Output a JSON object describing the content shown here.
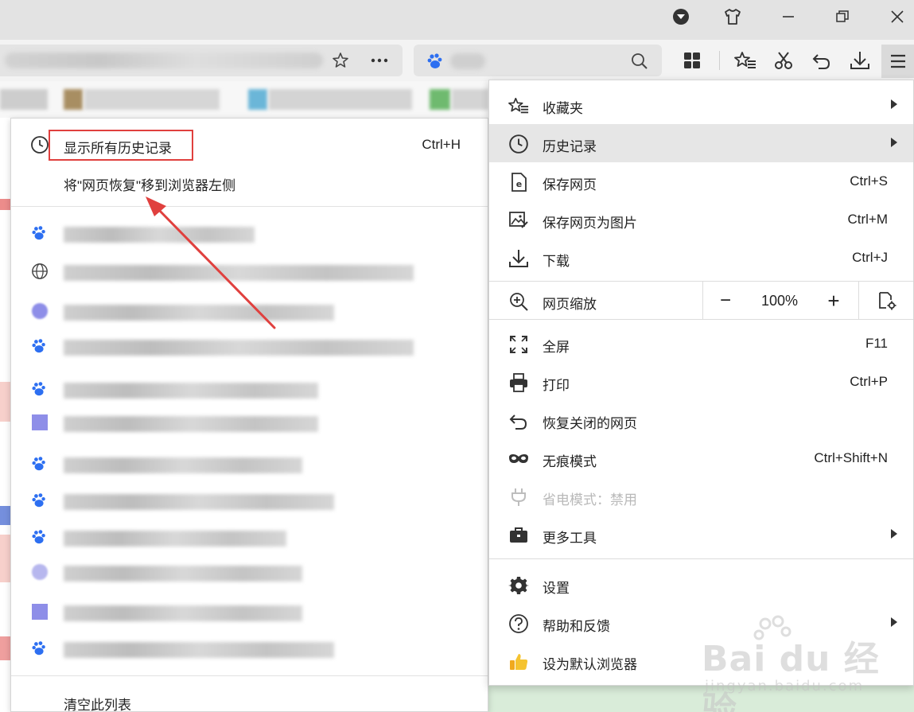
{
  "history_menu": {
    "show_all": {
      "label": "显示所有历史记录",
      "shortcut": "Ctrl+H"
    },
    "move_restore": {
      "label": "将\"网页恢复\"移到浏览器左侧"
    },
    "clear_list": {
      "label": "清空此列表"
    }
  },
  "main_menu": {
    "favorites": {
      "label": "收藏夹"
    },
    "history": {
      "label": "历史记录"
    },
    "save_page": {
      "label": "保存网页",
      "shortcut": "Ctrl+S"
    },
    "save_image": {
      "label": "保存网页为图片",
      "shortcut": "Ctrl+M"
    },
    "download": {
      "label": "下载",
      "shortcut": "Ctrl+J"
    },
    "zoom": {
      "label": "网页缩放",
      "minus": "−",
      "value": "100%",
      "plus": "+"
    },
    "fullscreen": {
      "label": "全屏",
      "shortcut": "F11"
    },
    "print": {
      "label": "打印",
      "shortcut": "Ctrl+P"
    },
    "restore_closed": {
      "label": "恢复关闭的网页"
    },
    "incognito": {
      "label": "无痕模式",
      "shortcut": "Ctrl+Shift+N"
    },
    "power_save": {
      "label": "省电模式：禁用"
    },
    "more_tools": {
      "label": "更多工具"
    },
    "settings": {
      "label": "设置"
    },
    "help": {
      "label": "帮助和反馈"
    },
    "set_default": {
      "label": "设为默认浏览器"
    }
  },
  "watermark": {
    "brand": "Bai du 经验",
    "url": "jingyan.baidu.com"
  },
  "colors": {
    "highlight_box": "#e0403e",
    "arrow": "#e0403e",
    "menu_active": "#e6e6e6",
    "page_green": "#d9ecd9"
  },
  "icons": [
    "shirt-icon",
    "minimize-icon",
    "restore-icon",
    "close-icon",
    "grid-apps-icon",
    "star-list-icon",
    "scissors-icon",
    "undo-icon",
    "download-icon",
    "hamburger-menu-icon",
    "baidu-paw-icon",
    "globe-icon",
    "clock-icon"
  ]
}
